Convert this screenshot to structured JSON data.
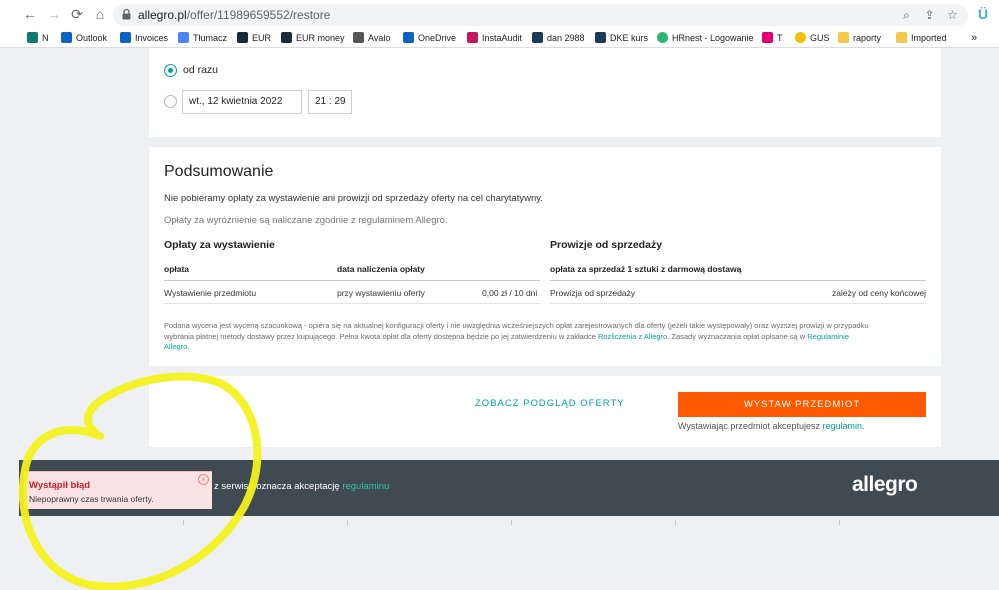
{
  "browser": {
    "url_host": "allegro.pl",
    "url_path": "/offer/11989659552/restore",
    "bookmarks": [
      {
        "label": "N",
        "color": "#0f7b6c"
      },
      {
        "label": "Outlook",
        "color": "#0a64c2"
      },
      {
        "label": "Invoices",
        "color": "#0a64c2"
      },
      {
        "label": "Tłumacz",
        "color": "#4b84f2"
      },
      {
        "label": "EUR",
        "color": "#1d2a3a"
      },
      {
        "label": "EUR money",
        "color": "#1d2a3a"
      },
      {
        "label": "Avalo",
        "color": "#555555"
      },
      {
        "label": "OneDrive",
        "color": "#0a64c2"
      },
      {
        "label": "InstaAudit",
        "color": "#c2185b"
      },
      {
        "label": "dan 2988",
        "color": "#1d3a5a"
      },
      {
        "label": "DKE kurs",
        "color": "#1d3a5a"
      },
      {
        "label": "HRnest - Logowanie",
        "color": "#2bb673"
      },
      {
        "label": "T",
        "color": "#e20074"
      },
      {
        "label": "GUS",
        "color": "#f2c200"
      },
      {
        "label": "raporty",
        "color": "#f2c94c"
      },
      {
        "label": "Imported",
        "color": "#f2c94c"
      }
    ],
    "overflow": "»",
    "ext_icon": "Ü"
  },
  "timing": {
    "option_now": "od razu",
    "date_value": "wt., 12 kwietnia 2022",
    "time_value": "21 : 29"
  },
  "summary": {
    "title": "Podsumowanie",
    "line1": "Nie pobieramy opłaty za wystawienie ani prowizji od sprzedaży oferty na cel charytatywny.",
    "line2": "Opłaty za wyróżnienie są naliczane zgodnie z regulaminem Allegro.",
    "fees_title": "Opłaty za wystawienie",
    "fees_headers": [
      "opłata",
      "data naliczenia opłaty"
    ],
    "fees_row": [
      "Wystawienie przedmiotu",
      "przy wystawieniu oferty",
      "0,00 zł / 10 dni"
    ],
    "comm_title": "Prowizje od sprzedaży",
    "comm_header": "opłata za sprzedaż 1 sztuki z darmową dostawą",
    "comm_row": [
      "Prowizja od sprzedaży",
      "zależy od ceny końcowej"
    ],
    "note_line1": "Podana wycena jest wyceną szacunkową - opiera się na aktualnej konfiguracji oferty i nie uwzględnia wcześniejszych opłat zarejestrowanych dla oferty (jeżeli takie występowały) oraz wyższej prowizji w przypadku",
    "note_line2a": "wybrania płatnej metody dostawy przez kupującego. Pełna kwota opłat dla oferty dostępna będzie po jej zatwierdzeniu w zakładce ",
    "note_link1": "Rozliczenia z Allegro",
    "note_line2b": ". Zasady wyznaczania opłat opisane są w ",
    "note_link2a": "Regulaminie",
    "note_link2b": "Allegro",
    "note_end": "."
  },
  "actions": {
    "preview": "ZOBACZ PODGLĄD OFERTY",
    "submit": "WYSTAW PRZEDMIOT",
    "accept_text": "Wystawiając przedmiot akceptujesz ",
    "accept_link": "regulamin",
    "accept_end": "."
  },
  "footer": {
    "text": "z serwisu oznacza akceptację ",
    "link": "regulaminu",
    "logo": "allegro"
  },
  "toast": {
    "title": "Wystąpił błąd",
    "message": "Niepoprawny czas trwania oferty."
  },
  "colors": {
    "accent": "#00a790",
    "primary": "#ff5a00",
    "error": "#c8202f",
    "footer_bg": "#3f4a52",
    "annotation": "#f3f11c"
  }
}
